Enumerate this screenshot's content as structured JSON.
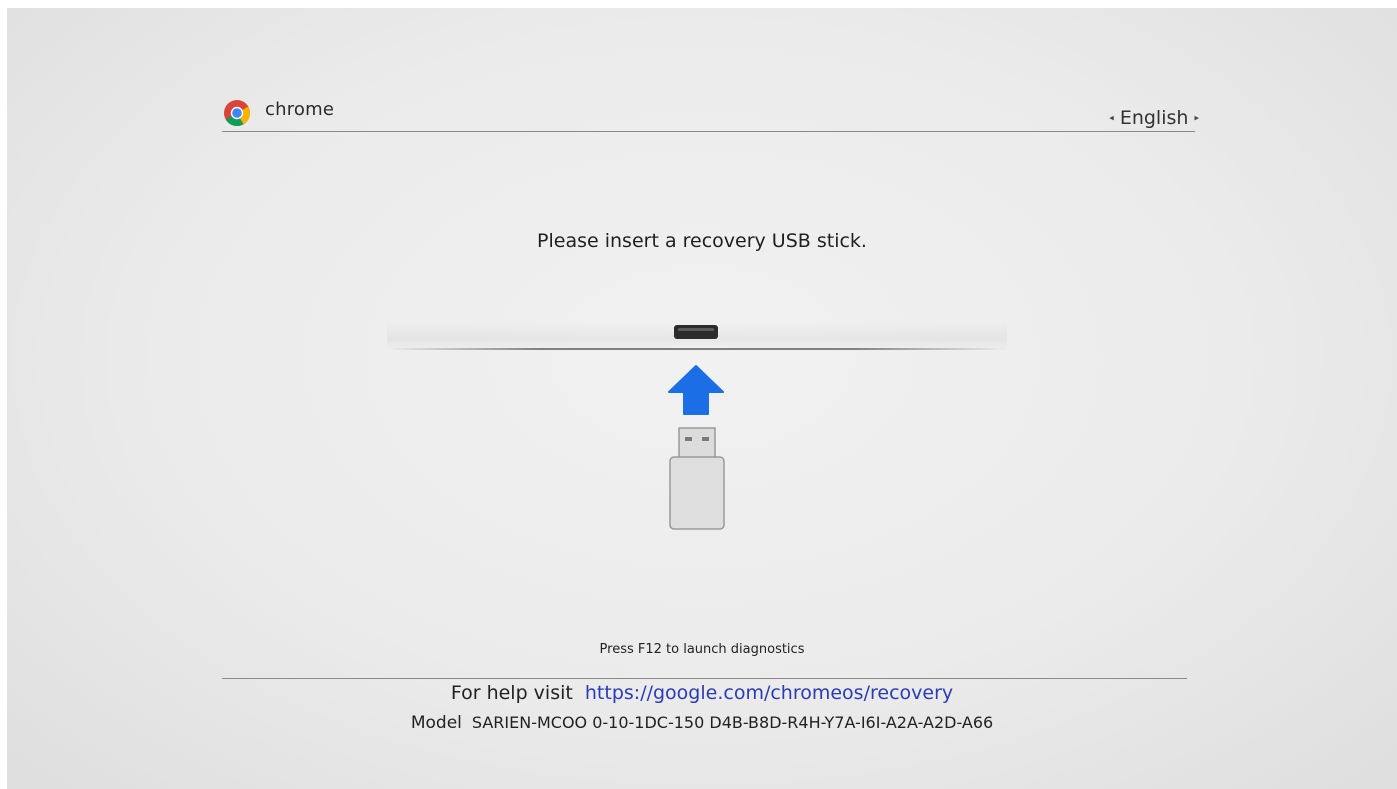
{
  "header": {
    "brand": "chrome",
    "language": "English",
    "language_prev_glyph": "◂",
    "language_next_glyph": "▸"
  },
  "main": {
    "message": "Please insert a recovery USB stick.",
    "illustration": {
      "port_icon": "usb-port-icon",
      "arrow_icon": "up-arrow-icon",
      "stick_icon": "usb-stick-icon",
      "arrow_color": "#1c6ee6"
    }
  },
  "footer": {
    "diagnostics_text": "Press F12 to launch diagnostics",
    "help_prefix": "For help visit",
    "help_url": "https://google.com/chromeos/recovery",
    "model_label": "Model",
    "model_value": "SARIEN-MCOO 0-10-1DC-150 D4B-B8D-R4H-Y7A-I6I-A2A-A2D-A66"
  },
  "colors": {
    "link": "#2a3bb8",
    "chrome_red": "#db4437",
    "chrome_yellow": "#f4b400",
    "chrome_green": "#0f9d58",
    "chrome_blue": "#4285f4"
  }
}
